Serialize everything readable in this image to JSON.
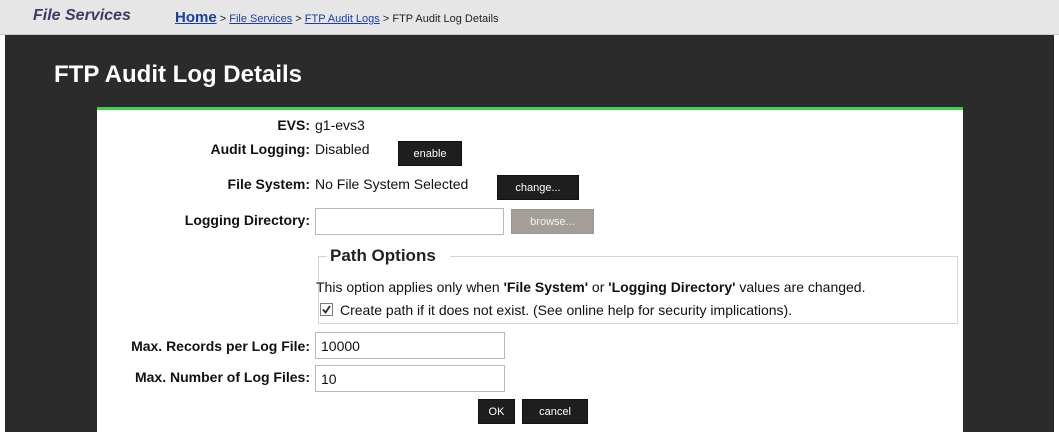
{
  "header": {
    "section_name": "File Services",
    "breadcrumb": {
      "home": "Home",
      "sep": ">",
      "file_services": "File Services",
      "ftp_audit_logs": "FTP Audit Logs",
      "current": "FTP Audit Log Details"
    }
  },
  "page": {
    "title": "FTP Audit Log Details"
  },
  "form": {
    "evs": {
      "label": "EVS:",
      "value": "g1-evs3"
    },
    "audit_logging": {
      "label": "Audit Logging:",
      "value": "Disabled",
      "button": "enable"
    },
    "file_system": {
      "label": "File System:",
      "value": "No File System Selected",
      "button": "change..."
    },
    "logging_directory": {
      "label": "Logging Directory:",
      "value": "",
      "button": "browse..."
    },
    "path_options": {
      "title": "Path Options",
      "text_prefix": "This option applies only when ",
      "term1": "'File System'",
      "text_mid": " or ",
      "term2": "'Logging Directory'",
      "text_suffix": " values are changed.",
      "checkbox_label": "Create path if it does not exist. (See online help for security implications).",
      "checkbox_checked": true
    },
    "max_records": {
      "label": "Max. Records per Log File:",
      "value": "10000"
    },
    "max_files": {
      "label": "Max. Number of Log Files:",
      "value": "10"
    }
  },
  "actions": {
    "ok": "OK",
    "cancel": "cancel"
  },
  "colors": {
    "accent_green": "#3bd44b",
    "panel_dark": "#2b2b2b",
    "link_blue": "#1a3ea8"
  }
}
